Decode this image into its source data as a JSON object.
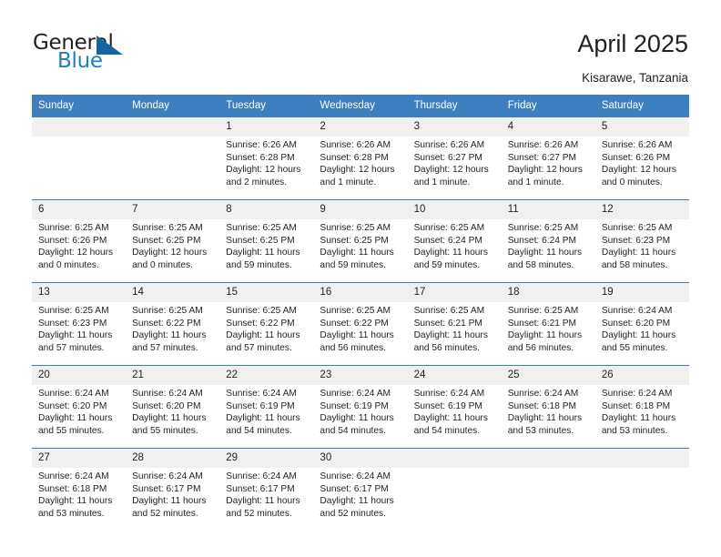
{
  "logo": {
    "word_top": "General",
    "word_bottom": "Blue",
    "triangle_color": "#15659f",
    "blue_color": "#1b7fc4"
  },
  "header": {
    "title": "April 2025",
    "location": "Kisarawe, Tanzania"
  },
  "theme": {
    "header_bg": "#3d7fbf",
    "daynum_bg": "#f0f0f0",
    "text": "#231f20"
  },
  "weekdays": [
    "Sunday",
    "Monday",
    "Tuesday",
    "Wednesday",
    "Thursday",
    "Friday",
    "Saturday"
  ],
  "weeks": [
    [
      {
        "day": "",
        "lines": []
      },
      {
        "day": "",
        "lines": []
      },
      {
        "day": "1",
        "lines": [
          "Sunrise: 6:26 AM",
          "Sunset: 6:28 PM",
          "Daylight: 12 hours",
          "and 2 minutes."
        ]
      },
      {
        "day": "2",
        "lines": [
          "Sunrise: 6:26 AM",
          "Sunset: 6:28 PM",
          "Daylight: 12 hours",
          "and 1 minute."
        ]
      },
      {
        "day": "3",
        "lines": [
          "Sunrise: 6:26 AM",
          "Sunset: 6:27 PM",
          "Daylight: 12 hours",
          "and 1 minute."
        ]
      },
      {
        "day": "4",
        "lines": [
          "Sunrise: 6:26 AM",
          "Sunset: 6:27 PM",
          "Daylight: 12 hours",
          "and 1 minute."
        ]
      },
      {
        "day": "5",
        "lines": [
          "Sunrise: 6:26 AM",
          "Sunset: 6:26 PM",
          "Daylight: 12 hours",
          "and 0 minutes."
        ]
      }
    ],
    [
      {
        "day": "6",
        "lines": [
          "Sunrise: 6:25 AM",
          "Sunset: 6:26 PM",
          "Daylight: 12 hours",
          "and 0 minutes."
        ]
      },
      {
        "day": "7",
        "lines": [
          "Sunrise: 6:25 AM",
          "Sunset: 6:25 PM",
          "Daylight: 12 hours",
          "and 0 minutes."
        ]
      },
      {
        "day": "8",
        "lines": [
          "Sunrise: 6:25 AM",
          "Sunset: 6:25 PM",
          "Daylight: 11 hours",
          "and 59 minutes."
        ]
      },
      {
        "day": "9",
        "lines": [
          "Sunrise: 6:25 AM",
          "Sunset: 6:25 PM",
          "Daylight: 11 hours",
          "and 59 minutes."
        ]
      },
      {
        "day": "10",
        "lines": [
          "Sunrise: 6:25 AM",
          "Sunset: 6:24 PM",
          "Daylight: 11 hours",
          "and 59 minutes."
        ]
      },
      {
        "day": "11",
        "lines": [
          "Sunrise: 6:25 AM",
          "Sunset: 6:24 PM",
          "Daylight: 11 hours",
          "and 58 minutes."
        ]
      },
      {
        "day": "12",
        "lines": [
          "Sunrise: 6:25 AM",
          "Sunset: 6:23 PM",
          "Daylight: 11 hours",
          "and 58 minutes."
        ]
      }
    ],
    [
      {
        "day": "13",
        "lines": [
          "Sunrise: 6:25 AM",
          "Sunset: 6:23 PM",
          "Daylight: 11 hours",
          "and 57 minutes."
        ]
      },
      {
        "day": "14",
        "lines": [
          "Sunrise: 6:25 AM",
          "Sunset: 6:22 PM",
          "Daylight: 11 hours",
          "and 57 minutes."
        ]
      },
      {
        "day": "15",
        "lines": [
          "Sunrise: 6:25 AM",
          "Sunset: 6:22 PM",
          "Daylight: 11 hours",
          "and 57 minutes."
        ]
      },
      {
        "day": "16",
        "lines": [
          "Sunrise: 6:25 AM",
          "Sunset: 6:22 PM",
          "Daylight: 11 hours",
          "and 56 minutes."
        ]
      },
      {
        "day": "17",
        "lines": [
          "Sunrise: 6:25 AM",
          "Sunset: 6:21 PM",
          "Daylight: 11 hours",
          "and 56 minutes."
        ]
      },
      {
        "day": "18",
        "lines": [
          "Sunrise: 6:25 AM",
          "Sunset: 6:21 PM",
          "Daylight: 11 hours",
          "and 56 minutes."
        ]
      },
      {
        "day": "19",
        "lines": [
          "Sunrise: 6:24 AM",
          "Sunset: 6:20 PM",
          "Daylight: 11 hours",
          "and 55 minutes."
        ]
      }
    ],
    [
      {
        "day": "20",
        "lines": [
          "Sunrise: 6:24 AM",
          "Sunset: 6:20 PM",
          "Daylight: 11 hours",
          "and 55 minutes."
        ]
      },
      {
        "day": "21",
        "lines": [
          "Sunrise: 6:24 AM",
          "Sunset: 6:20 PM",
          "Daylight: 11 hours",
          "and 55 minutes."
        ]
      },
      {
        "day": "22",
        "lines": [
          "Sunrise: 6:24 AM",
          "Sunset: 6:19 PM",
          "Daylight: 11 hours",
          "and 54 minutes."
        ]
      },
      {
        "day": "23",
        "lines": [
          "Sunrise: 6:24 AM",
          "Sunset: 6:19 PM",
          "Daylight: 11 hours",
          "and 54 minutes."
        ]
      },
      {
        "day": "24",
        "lines": [
          "Sunrise: 6:24 AM",
          "Sunset: 6:19 PM",
          "Daylight: 11 hours",
          "and 54 minutes."
        ]
      },
      {
        "day": "25",
        "lines": [
          "Sunrise: 6:24 AM",
          "Sunset: 6:18 PM",
          "Daylight: 11 hours",
          "and 53 minutes."
        ]
      },
      {
        "day": "26",
        "lines": [
          "Sunrise: 6:24 AM",
          "Sunset: 6:18 PM",
          "Daylight: 11 hours",
          "and 53 minutes."
        ]
      }
    ],
    [
      {
        "day": "27",
        "lines": [
          "Sunrise: 6:24 AM",
          "Sunset: 6:18 PM",
          "Daylight: 11 hours",
          "and 53 minutes."
        ]
      },
      {
        "day": "28",
        "lines": [
          "Sunrise: 6:24 AM",
          "Sunset: 6:17 PM",
          "Daylight: 11 hours",
          "and 52 minutes."
        ]
      },
      {
        "day": "29",
        "lines": [
          "Sunrise: 6:24 AM",
          "Sunset: 6:17 PM",
          "Daylight: 11 hours",
          "and 52 minutes."
        ]
      },
      {
        "day": "30",
        "lines": [
          "Sunrise: 6:24 AM",
          "Sunset: 6:17 PM",
          "Daylight: 11 hours",
          "and 52 minutes."
        ]
      },
      {
        "day": "",
        "lines": []
      },
      {
        "day": "",
        "lines": []
      },
      {
        "day": "",
        "lines": []
      }
    ]
  ]
}
